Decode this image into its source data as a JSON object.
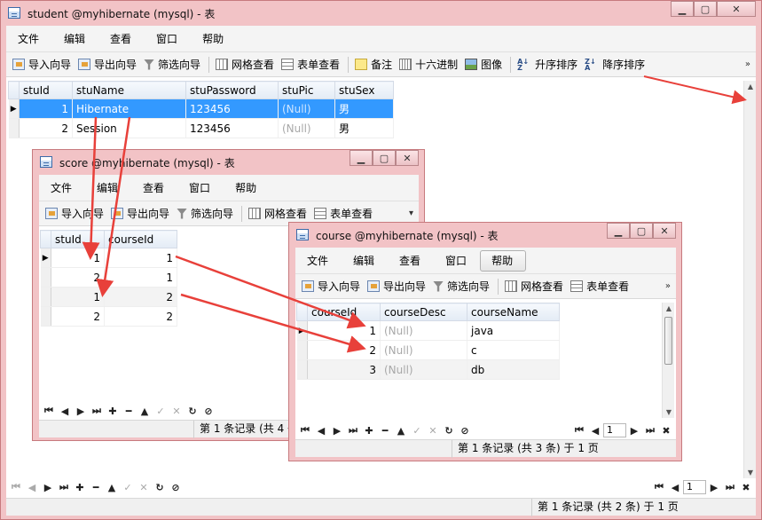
{
  "student_window": {
    "title": "student @myhibernate (mysql) - 表",
    "menu": [
      "文件",
      "编辑",
      "查看",
      "窗口",
      "帮助"
    ],
    "toolbar": [
      "导入向导",
      "导出向导",
      "筛选向导",
      "网格查看",
      "表单查看",
      "备注",
      "十六进制",
      "图像",
      "升序排序",
      "降序排序"
    ],
    "columns": [
      "stuId",
      "stuName",
      "stuPassword",
      "stuPic",
      "stuSex"
    ],
    "rows": [
      [
        "1",
        "Hibernate",
        "123456",
        "(Null)",
        "男"
      ],
      [
        "2",
        "Session",
        "123456",
        "(Null)",
        "男"
      ]
    ],
    "status": "第 1 条记录 (共 2 条) 于 1 页",
    "page": "1"
  },
  "score_window": {
    "title": "score @myhibernate (mysql) - 表",
    "menu": [
      "文件",
      "编辑",
      "查看",
      "窗口",
      "帮助"
    ],
    "toolbar": [
      "导入向导",
      "导出向导",
      "筛选向导",
      "网格查看",
      "表单查看"
    ],
    "columns": [
      "stuId",
      "courseId"
    ],
    "rows": [
      [
        "1",
        "1"
      ],
      [
        "2",
        "1"
      ],
      [
        "1",
        "2"
      ],
      [
        "2",
        "2"
      ]
    ],
    "status": "第 1 条记录 (共 4 条"
  },
  "course_window": {
    "title": "course @myhibernate (mysql) - 表",
    "menu": [
      "文件",
      "编辑",
      "查看",
      "窗口",
      "帮助"
    ],
    "toolbar": [
      "导入向导",
      "导出向导",
      "筛选向导",
      "网格查看",
      "表单查看"
    ],
    "columns": [
      "courseId",
      "courseDesc",
      "courseName"
    ],
    "rows": [
      [
        "1",
        "(Null)",
        "java"
      ],
      [
        "2",
        "(Null)",
        "c"
      ],
      [
        "3",
        "(Null)",
        "db"
      ]
    ],
    "status": "第 1 条记录 (共 3 条) 于 1 页",
    "page": "1"
  },
  "colors": {
    "selection": "#3399ff",
    "arrow": "#e8403a",
    "frame": "#f2c3c6"
  }
}
